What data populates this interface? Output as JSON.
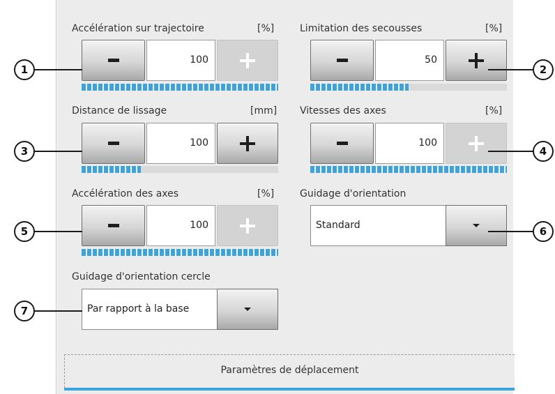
{
  "controls": {
    "path_accel": {
      "label": "Accélération sur trajectoire",
      "unit": "[%]",
      "value": "100",
      "level_percent": 100,
      "minus": "-",
      "plus_enabled": false
    },
    "jerk_limit": {
      "label": "Limitation des secousses",
      "unit": "[%]",
      "value": "50",
      "level_percent": 50,
      "minus": "-",
      "plus_enabled": true
    },
    "smoothing_distance": {
      "label": "Distance de lissage",
      "unit": "[mm]",
      "value": "100",
      "level_percent": 30,
      "minus": "-",
      "plus_enabled": true
    },
    "axis_speed": {
      "label": "Vitesses des axes",
      "unit": "[%]",
      "value": "100",
      "level_percent": 100,
      "minus": "-",
      "plus_enabled": false
    },
    "axis_accel": {
      "label": "Accélération des axes",
      "unit": "[%]",
      "value": "100",
      "level_percent": 100,
      "minus": "-",
      "plus_enabled": false
    }
  },
  "orientation_guidance": {
    "label": "Guidage d'orientation",
    "value": "Standard"
  },
  "circle_orientation_guidance": {
    "label": "Guidage d'orientation cercle",
    "value": "Par rapport à la base"
  },
  "footer_tab": {
    "label": "Paramètres de déplacement"
  },
  "callouts": [
    "1",
    "2",
    "3",
    "4",
    "5",
    "6",
    "7"
  ],
  "colors": {
    "bar_fill": "#3ba4dc",
    "panel_bg": "#ececec"
  },
  "icons": {
    "minus": "minus-icon",
    "plus": "plus-icon",
    "dropdown": "triangle-down-icon"
  }
}
